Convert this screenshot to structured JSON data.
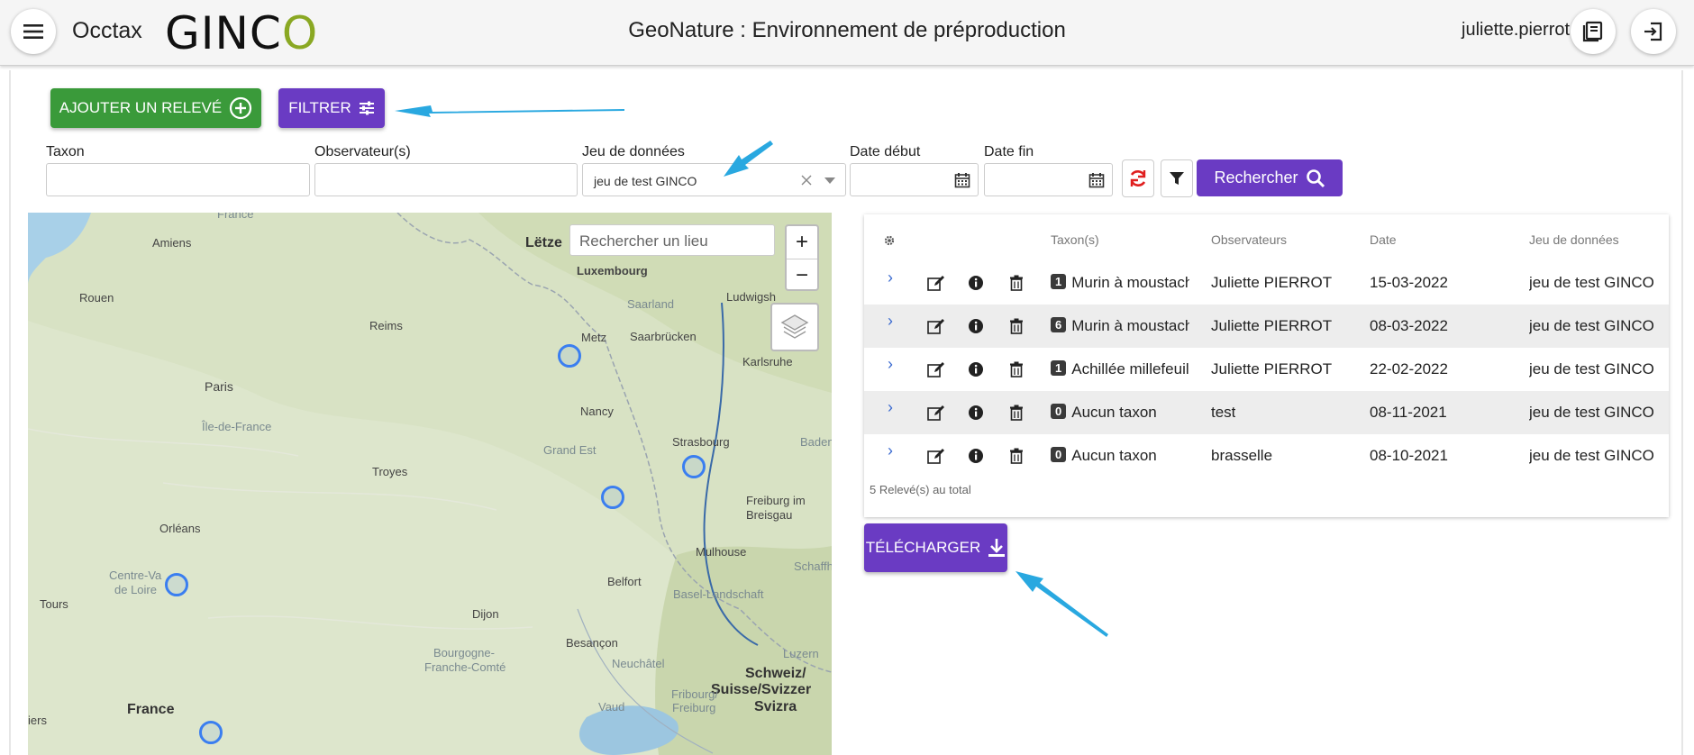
{
  "header": {
    "menu_icon": "hamburger-menu-icon",
    "app_name": "Occtax",
    "logo_text_dark": "GINC",
    "logo_text_green": "O",
    "environment_title": "GeoNature : Environnement de préproduction",
    "username": "juliette.pierrot",
    "docs_icon": "book-icon",
    "logout_icon": "logout-icon"
  },
  "actions": {
    "add_label": "AJOUTER UN RELEVÉ",
    "filter_label": "FILTRER",
    "download_label": "TÉLÉCHARGER"
  },
  "filters": {
    "taxon_label": "Taxon",
    "taxon_value": "",
    "observer_label": "Observateur(s)",
    "observer_value": "",
    "dataset_label": "Jeu de données",
    "dataset_value": "jeu de test GINCO",
    "date_start_label": "Date début",
    "date_start_value": "",
    "date_end_label": "Date fin",
    "date_end_value": "",
    "search_label": "Rechercher"
  },
  "map": {
    "search_placeholder": "Rechercher un lieu",
    "zoom_in": "+",
    "zoom_out": "−",
    "labels": {
      "letze": "Lëtze",
      "amiens": "Amiens",
      "france_top": "France",
      "luxembourg": "Luxembourg",
      "saarland": "Saarland",
      "ludwigsh": "Ludwigsh",
      "rouen": "Rouen",
      "reims": "Reims",
      "metz": "Metz",
      "saarbrucken": "Saarbrücken",
      "karlsruhe": "Karlsruhe",
      "paris": "Paris",
      "ile_de_france": "Île-de-France",
      "nancy": "Nancy",
      "strasbourg": "Strasbourg",
      "baden": "Baden",
      "grand_est": "Grand Est",
      "troyes": "Troyes",
      "freiburg": "Freiburg im",
      "breisgau": "Breisgau",
      "orleans": "Orléans",
      "centre_val": "Centre-Va",
      "de_loire": "de Loire",
      "tours": "Tours",
      "mulhouse": "Mulhouse",
      "schaffh": "Schaffh",
      "belfort": "Belfort",
      "basel": "Basel-Landschaft",
      "dijon": "Dijon",
      "besancon": "Besançon",
      "luzern": "Luzern",
      "bourgogne": "Bourgogne-",
      "franche_comte": "Franche-Comté",
      "neuchatel": "Neuchâtel",
      "schweiz": "Schweiz/",
      "suisse": "Suisse/Svizzer",
      "svizra": "Svizra",
      "fribourg": "Fribourg/",
      "freiburg2": "Freiburg",
      "vaud": "Vaud",
      "france": "France",
      "iers": "iers"
    }
  },
  "table": {
    "columns": [
      "Taxon(s)",
      "Observateurs",
      "Date",
      "Jeu de données"
    ],
    "settings_icon": "gear-icon",
    "rows": [
      {
        "count": "1",
        "taxon": "Murin à moustach",
        "observer": "Juliette PIERROT",
        "date": "15-03-2022",
        "dataset": "jeu de test GINCO"
      },
      {
        "count": "6",
        "taxon": "Murin à moustach",
        "observer": "Juliette PIERROT",
        "date": "08-03-2022",
        "dataset": "jeu de test GINCO"
      },
      {
        "count": "1",
        "taxon": "Achillée millefeuill",
        "observer": "Juliette PIERROT",
        "date": "22-02-2022",
        "dataset": "jeu de test GINCO"
      },
      {
        "count": "0",
        "taxon": "Aucun taxon",
        "observer": "test",
        "date": "08-11-2021",
        "dataset": "jeu de test GINCO"
      },
      {
        "count": "0",
        "taxon": "Aucun taxon",
        "observer": "brasselle",
        "date": "08-10-2021",
        "dataset": "jeu de test GINCO"
      }
    ],
    "total": "5 Relevé(s) au total"
  },
  "colors": {
    "accent_purple": "#6a3bc3",
    "accent_green": "#3a9a3a",
    "annotation_arrow": "#29a8e0",
    "marker_blue": "#3a7ef0"
  }
}
